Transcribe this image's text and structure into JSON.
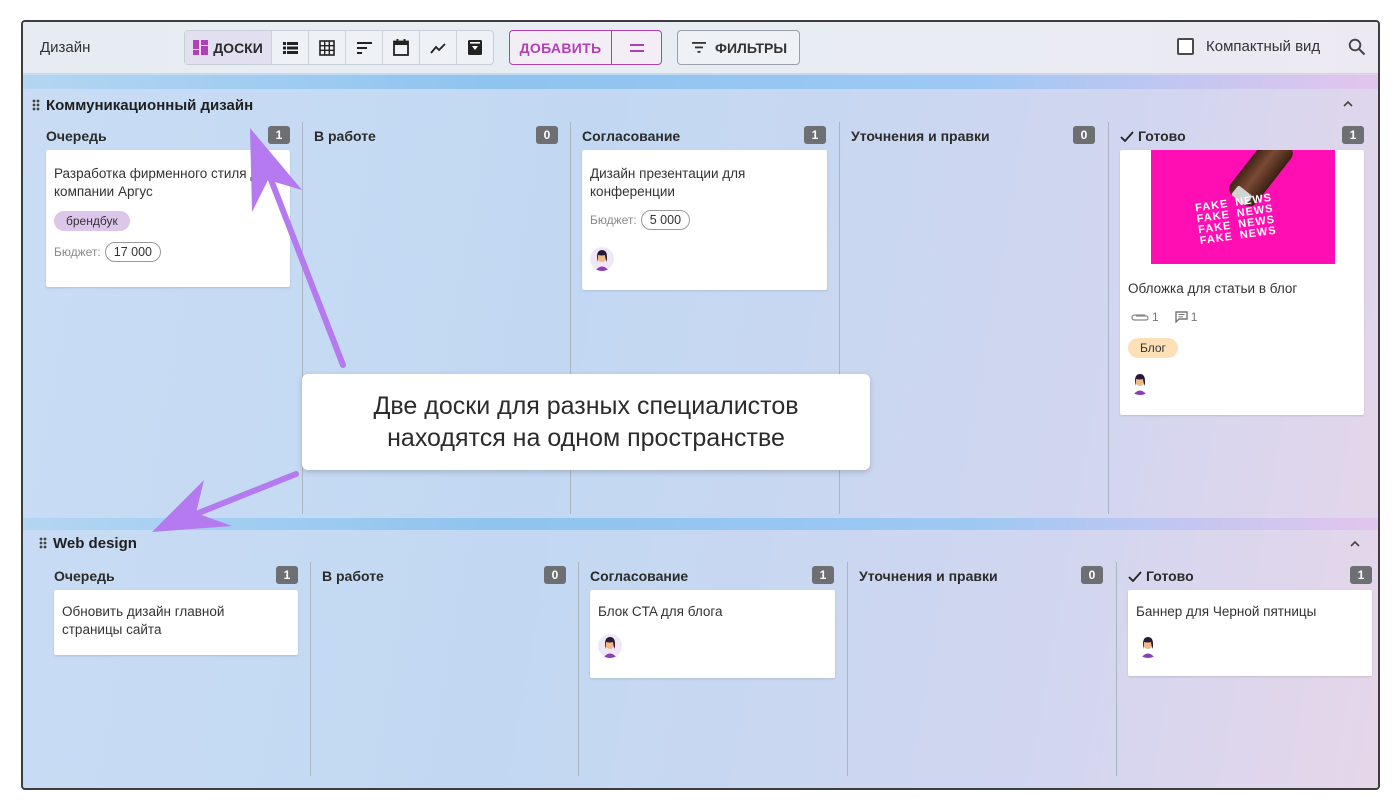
{
  "toolbar": {
    "app_title": "Дизайн",
    "view_tabs": [
      {
        "label": "ДОСКИ",
        "icon": "boards-icon",
        "active": true
      },
      {
        "label": "",
        "icon": "list-icon"
      },
      {
        "label": "",
        "icon": "table-icon"
      },
      {
        "label": "",
        "icon": "gantt-icon"
      },
      {
        "label": "",
        "icon": "calendar-icon"
      },
      {
        "label": "",
        "icon": "chart-icon"
      },
      {
        "label": "",
        "icon": "archive-icon"
      }
    ],
    "add_label": "ДОБАВИТЬ",
    "filters_label": "ФИЛЬТРЫ",
    "compact_label": "Компактный вид",
    "compact_checked": false,
    "accent_color": "#b23fb7"
  },
  "boards": [
    {
      "title": "Коммуникационный дизайн",
      "columns": [
        {
          "title": "Очередь",
          "count": "1"
        },
        {
          "title": "В работе",
          "count": "0"
        },
        {
          "title": "Согласование",
          "count": "1"
        },
        {
          "title": "Уточнения и правки",
          "count": "0"
        },
        {
          "title": "Готово",
          "count": "1",
          "done": true
        }
      ],
      "cards": {
        "c1": {
          "title": "Разработка фирменного стиля для компании Аргус",
          "tag": "брендбук",
          "budget_label": "Бюджет:",
          "budget_value": "17 000"
        },
        "c2": {
          "title": "Дизайн презентации для конференции",
          "budget_label": "Бюджет:",
          "budget_value": "5 000",
          "avatar": "avatar"
        },
        "c3": {
          "title": "Обложка для статьи в блог",
          "cover_text": "FAKE NEWS FAKE NEWS FAKE NEWS FAKE NEWS",
          "attachments": "1",
          "comments": "1",
          "tag": "Блог",
          "avatar": "avatar"
        }
      }
    },
    {
      "title": "Web design",
      "columns": [
        {
          "title": "Очередь",
          "count": "1"
        },
        {
          "title": "В работе",
          "count": "0"
        },
        {
          "title": "Согласование",
          "count": "1"
        },
        {
          "title": "Уточнения и правки",
          "count": "0"
        },
        {
          "title": "Готово",
          "count": "1",
          "done": true
        }
      ],
      "cards": {
        "c1": {
          "title": "Обновить дизайн главной страницы сайта"
        },
        "c2": {
          "title": "Блок CTA для блога",
          "avatar": "avatar"
        },
        "c3": {
          "title": "Баннер для Черной пятницы",
          "avatar": "avatar"
        }
      }
    }
  ],
  "annotation": {
    "line1": "Две доски для разных специалистов",
    "line2": "находятся на одном пространстве",
    "arrow_color": "#b57af0"
  }
}
